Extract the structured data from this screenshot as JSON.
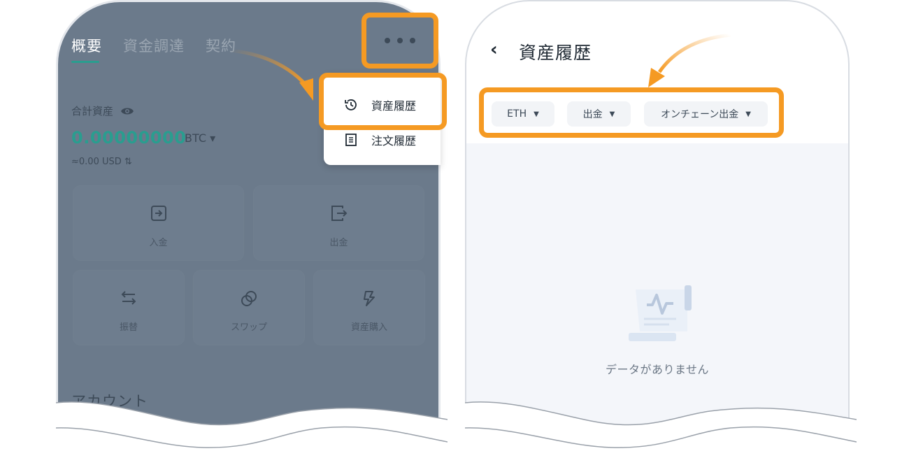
{
  "left": {
    "tabs": [
      {
        "label": "概要"
      },
      {
        "label": "資金調達"
      },
      {
        "label": "契約"
      }
    ],
    "menu": {
      "asset_history": "資産履歴",
      "order_history": "注文履歴"
    },
    "total_assets_label": "合計資産",
    "total_assets_value": "0.00000000",
    "total_assets_unit": "BTC ▾",
    "usd_value": "≈0.00 USD ⇅",
    "actions": {
      "deposit": "入金",
      "withdraw": "出金",
      "transfer": "振替",
      "swap": "スワップ",
      "buy": "資産購入"
    },
    "account_title": "アカウント"
  },
  "right": {
    "title": "資産履歴",
    "filters": {
      "coin": "ETH",
      "type": "出金",
      "method": "オンチェーン出金"
    },
    "empty_text": "データがありません"
  },
  "colors": {
    "highlight": "#f59a23",
    "accent": "#2a9d8f",
    "overlay": "#6b7a8b"
  }
}
